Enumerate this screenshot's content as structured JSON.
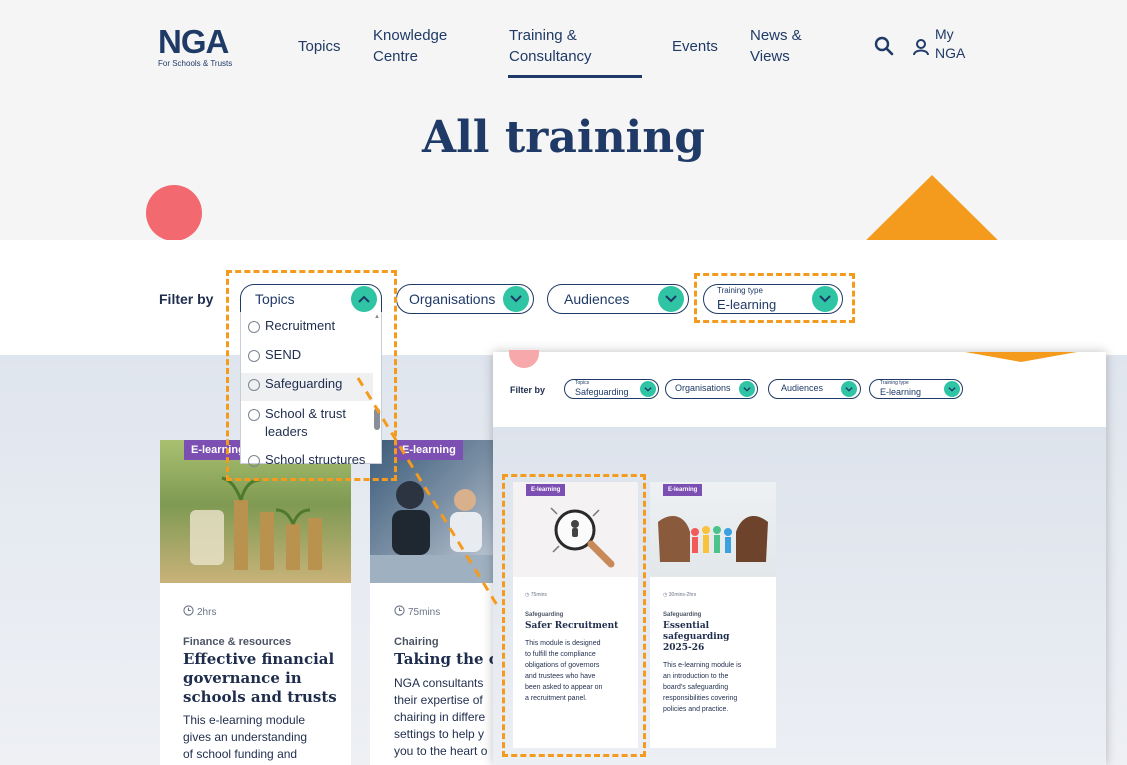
{
  "logo": {
    "mark": "NGA",
    "subtitle": "For Schools & Trusts"
  },
  "nav": {
    "topics": "Topics",
    "knowledge_l1": "Knowledge",
    "knowledge_l2": "Centre",
    "training_l1": "Training &",
    "training_l2": "Consultancy",
    "events": "Events",
    "news_l1": "News &",
    "news_l2": "Views",
    "my_l1": "My",
    "my_l2": "NGA"
  },
  "page_title": "All training",
  "filters": {
    "label": "Filter by",
    "topics": "Topics",
    "organisations": "Organisations",
    "audiences": "Audiences",
    "training_type_caption": "Training type",
    "training_type_value": "E-learning"
  },
  "topics_dropdown": {
    "options": [
      "Recruitment",
      "SEND",
      "Safeguarding",
      "School & trust",
      "leaders",
      "School structures"
    ]
  },
  "cards": [
    {
      "badge": "E-learning",
      "duration": "2hrs",
      "category": "Finance & resources",
      "title_l1": "Effective financial",
      "title_l2": "governance in",
      "title_l3": "schools and trusts",
      "desc_l1": "This e-learning module",
      "desc_l2": "gives an understanding",
      "desc_l3": "of school funding and"
    },
    {
      "badge": "E-learning",
      "duration": "75mins",
      "category": "Chairing",
      "title_l1": "Taking the ch",
      "desc_l1": "NGA consultants",
      "desc_l2": "their expertise of",
      "desc_l3": "chairing in differe",
      "desc_l4": "settings to help y",
      "desc_l5": "you to the heart o"
    }
  ],
  "overlay": {
    "filter_label": "Filter by",
    "topics_caption": "Topics",
    "topics_value": "Safeguarding",
    "organisations": "Organisations",
    "audiences": "Audiences",
    "type_caption": "Training type",
    "type_value": "E-learning",
    "cards": [
      {
        "badge": "E-learning",
        "duration": "75mins",
        "category": "Safeguarding",
        "title_l1": "Safer Recruitment",
        "desc": [
          "This module is designed",
          "to fulfill the compliance",
          "obligations of governors",
          "and trustees who have",
          "been asked to appear on",
          "a recruitment panel."
        ]
      },
      {
        "badge": "E-learning",
        "duration": "30mins-2hrs",
        "category": "Safeguarding",
        "title_l1": "Essential",
        "title_l2": "safeguarding",
        "title_l3": "2025-26",
        "desc": [
          "This e-learning module is",
          "an introduction to the",
          "board's safeguarding",
          "responsibilities covering",
          "policies and practice."
        ]
      }
    ]
  },
  "colors": {
    "navy": "#1f3a66",
    "teal": "#2ec4a4",
    "orange": "#f49a1c",
    "coral": "#f26a6f",
    "purple": "#7c4fb3"
  }
}
